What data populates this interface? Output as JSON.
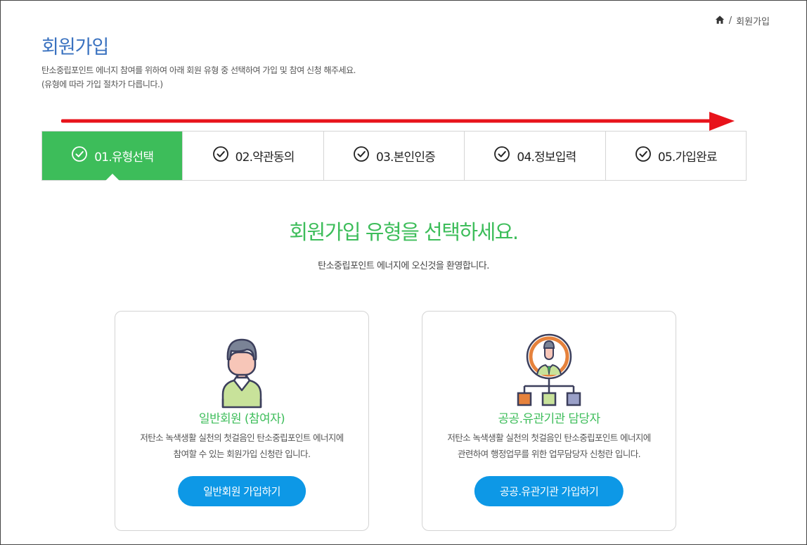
{
  "breadcrumb": {
    "home_icon": "home-icon",
    "current": "회원가입"
  },
  "page": {
    "title": "회원가입",
    "description_line1": "탄소중립포인트 에너지 참여를 위하여 아래 회원 유형 중 선택하여 가입 및 참여 신청 해주세요.",
    "description_line2": "(유형에 따라 가입 절차가 다릅니다.)"
  },
  "steps": [
    {
      "label": "01.유형선택",
      "active": true,
      "icon": "check-circle-icon"
    },
    {
      "label": "02.약관동의",
      "active": false,
      "icon": "check-circle-icon"
    },
    {
      "label": "03.본인인증",
      "active": false,
      "icon": "check-circle-icon"
    },
    {
      "label": "04.정보입력",
      "active": false,
      "icon": "check-circle-icon"
    },
    {
      "label": "05.가입완료",
      "active": false,
      "icon": "check-circle-icon"
    }
  ],
  "main": {
    "headline": "회원가입 유형을 선택하세요.",
    "welcome": "탄소중립포인트 에너지에 오신것을 환영합니다."
  },
  "cards": [
    {
      "icon": "person-icon",
      "title": "일반회원 (참여자)",
      "desc_line1": "저탄소 녹색생활 실천의 첫걸음인 탄소중립포인트 에너지에",
      "desc_line2": "참여할 수 있는 회원가입 신청란 입니다.",
      "button": "일반회원 가입하기"
    },
    {
      "icon": "organization-manager-icon",
      "title": "공공.유관기관 담당자",
      "desc_line1": "저탄소 녹색생활 실천의 첫걸음인 탄소중립포인트 에너지에",
      "desc_line2": "관련하여 행정업무를 위한 업무담당자 신청란 입니다.",
      "button": "공공.유관기관 가입하기"
    }
  ],
  "colors": {
    "accent_green": "#3dbd5a",
    "title_blue": "#3a72c0",
    "button_blue": "#0d98e6",
    "annotation_red": "#e8131b"
  }
}
